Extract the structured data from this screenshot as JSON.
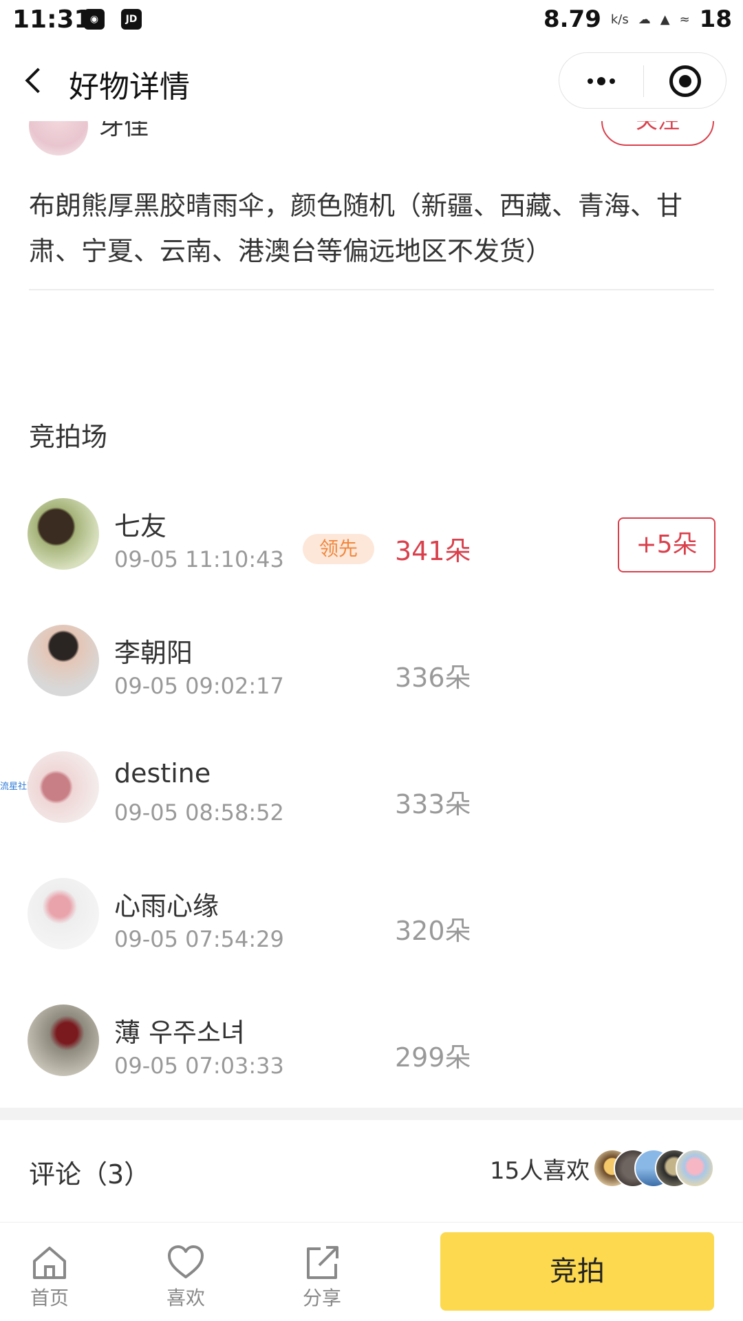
{
  "status_bar": {
    "time": "11:31",
    "left_icons": [
      "qq-icon",
      "jd-icon"
    ],
    "jd_label": "JD",
    "network_speed": "8.79",
    "network_unit": "k/s",
    "battery": "18"
  },
  "nav": {
    "title": "好物详情"
  },
  "seller": {
    "name": "牙佳",
    "follow_label": "关注"
  },
  "description": "布朗熊厚黑胶晴雨伞，颜色随机（新疆、西藏、青海、甘肃、宁夏、云南、港澳台等偏远地区不发货）",
  "auction": {
    "title": "竞拍场",
    "lead_label": "领先",
    "plus_label": "+5朵",
    "bids": [
      {
        "name": "七友",
        "time": "09-05 11:10:43",
        "amount": "341朵"
      },
      {
        "name": "李朝阳",
        "time": "09-05 09:02:17",
        "amount": "336朵"
      },
      {
        "name": "destine",
        "time": "09-05 08:58:52",
        "amount": "333朵"
      },
      {
        "name": "心雨心缘",
        "time": "09-05 07:54:29",
        "amount": "320朵"
      },
      {
        "name": "薄 우주소녀",
        "time": "09-05 07:03:33",
        "amount": "299朵"
      }
    ],
    "watermark": "流星社区"
  },
  "comments": {
    "title": "评论（3）",
    "likes": "15人喜欢"
  },
  "bottom_bar": {
    "tabs": [
      {
        "label": "首页",
        "icon": "home-icon"
      },
      {
        "label": "喜欢",
        "icon": "heart-icon"
      },
      {
        "label": "分享",
        "icon": "share-icon"
      }
    ],
    "bid_button": "竞拍"
  },
  "colors": {
    "accent_red": "#d9404c",
    "lead_orange": "#f0883e",
    "bid_yellow": "#fcd94e"
  }
}
